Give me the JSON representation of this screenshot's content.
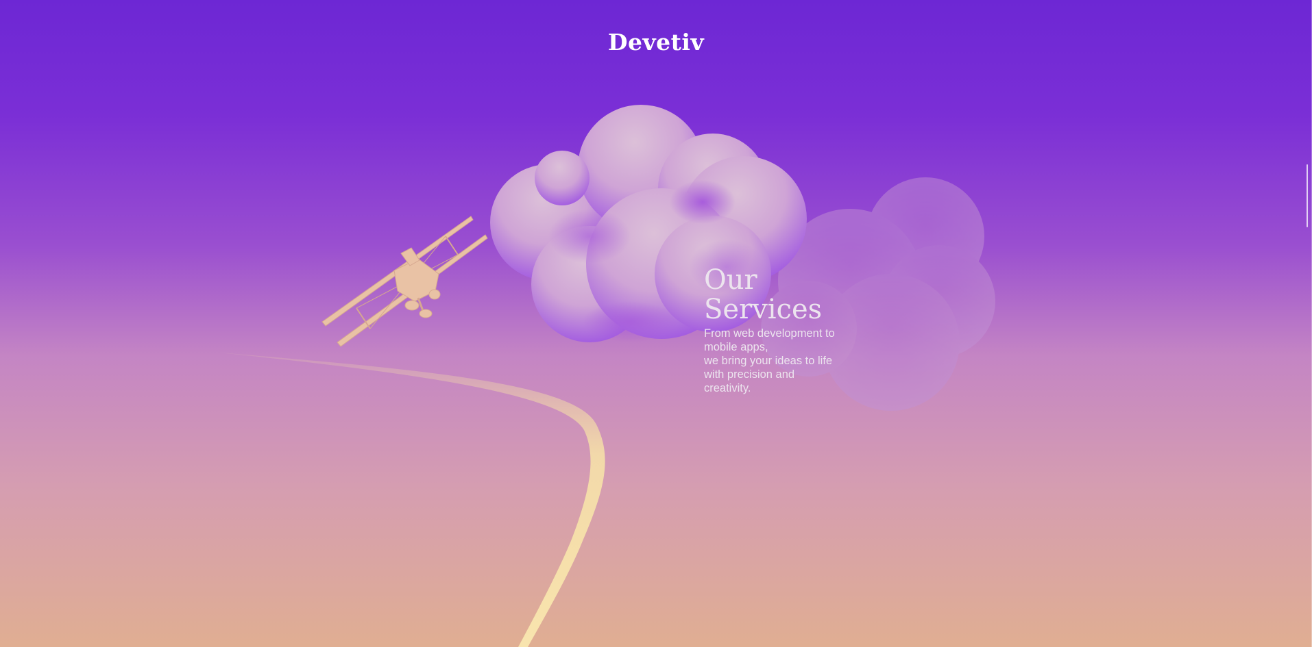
{
  "brand": {
    "logo_text": "Devetiv"
  },
  "hero": {
    "heading_line1": "Our",
    "heading_line2": "Services",
    "body_lines": [
      "From web development to",
      "mobile apps,",
      "we bring your ideas to life",
      "with precision and",
      "creativity."
    ]
  },
  "colors": {
    "sky_top": "#6d27d4",
    "sky_bottom": "#e0ae92",
    "trail": "#f6e0a8",
    "plane": "#e8c0a4",
    "cloud_light": "#d9b8d6",
    "cloud_shadow": "#9c4fde"
  },
  "icons": {
    "plane": "biplane-illustration",
    "cloud_main": "cloud-illustration",
    "cloud_back": "cloud-illustration"
  }
}
